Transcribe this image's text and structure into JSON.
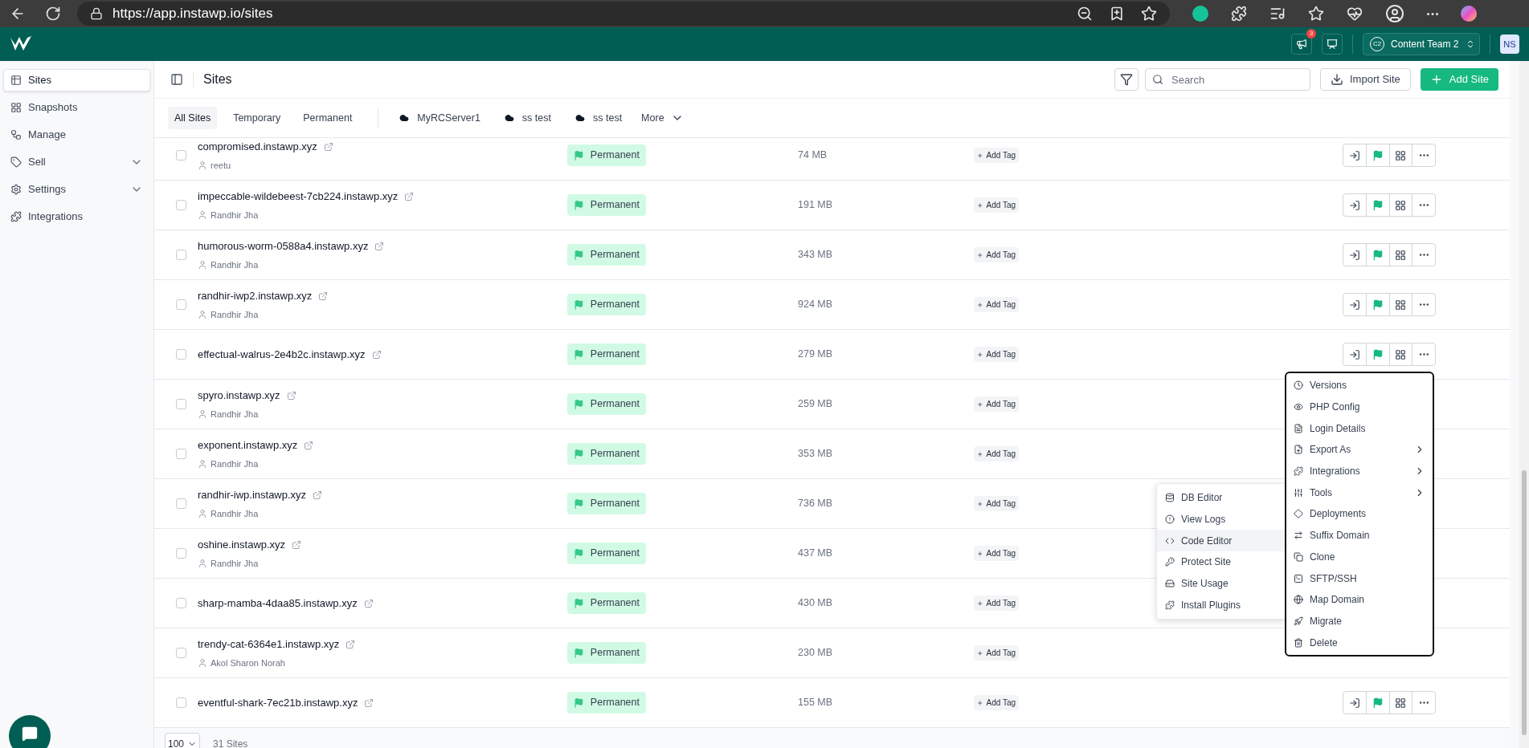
{
  "browser": {
    "url": "https://app.instawp.io/sites"
  },
  "header": {
    "notification_count": "3",
    "team": {
      "initials": "C2",
      "name": "Content Team 2"
    },
    "avatar": "NS"
  },
  "sidebar": {
    "items": [
      {
        "label": "Sites",
        "selected": true,
        "expandable": false
      },
      {
        "label": "Snapshots",
        "selected": false,
        "expandable": false
      },
      {
        "label": "Manage",
        "selected": false,
        "expandable": false
      },
      {
        "label": "Sell",
        "selected": false,
        "expandable": true
      },
      {
        "label": "Settings",
        "selected": false,
        "expandable": true
      },
      {
        "label": "Integrations",
        "selected": false,
        "expandable": false
      }
    ]
  },
  "page": {
    "title": "Sites",
    "search_placeholder": "Search",
    "import_button": "Import Site",
    "add_button": "Add Site"
  },
  "tabs": [
    {
      "label": "All Sites",
      "selected": true,
      "kind": "filter"
    },
    {
      "label": "Temporary",
      "selected": false,
      "kind": "filter"
    },
    {
      "label": "Permanent",
      "selected": false,
      "kind": "filter"
    },
    {
      "label": "MyRCServer1",
      "selected": false,
      "kind": "server"
    },
    {
      "label": "ss test",
      "selected": false,
      "kind": "server"
    },
    {
      "label": "ss test",
      "selected": false,
      "kind": "server"
    }
  ],
  "more_tab": "More",
  "rows": [
    {
      "name": "compromised.instawp.xyz",
      "user": "reetu",
      "status": "Permanent",
      "size": "74 MB",
      "tag_button": "Add Tag",
      "checked": false,
      "actions_shown": true
    },
    {
      "name": "impeccable-wildebeest-7cb224.instawp.xyz",
      "user": "Randhir Jha",
      "status": "Permanent",
      "size": "191 MB",
      "tag_button": "Add Tag",
      "checked": false,
      "actions_shown": true
    },
    {
      "name": "humorous-worm-0588a4.instawp.xyz",
      "user": "Randhir Jha",
      "status": "Permanent",
      "size": "343 MB",
      "tag_button": "Add Tag",
      "checked": false,
      "actions_shown": true
    },
    {
      "name": "randhir-iwp2.instawp.xyz",
      "user": "Randhir Jha",
      "status": "Permanent",
      "size": "924 MB",
      "tag_button": "Add Tag",
      "checked": false,
      "actions_shown": true
    },
    {
      "name": "effectual-walrus-2e4b2c.instawp.xyz",
      "status": "Permanent",
      "size": "279 MB",
      "tag_button": "Add Tag",
      "checked": false,
      "actions_shown": true
    },
    {
      "name": "spyro.instawp.xyz",
      "user": "Randhir Jha",
      "status": "Permanent",
      "size": "259 MB",
      "tag_button": "Add Tag",
      "checked": false,
      "actions_shown": false
    },
    {
      "name": "exponent.instawp.xyz",
      "user": "Randhir Jha",
      "status": "Permanent",
      "size": "353 MB",
      "tag_button": "Add Tag",
      "checked": false,
      "actions_shown": false
    },
    {
      "name": "randhir-iwp.instawp.xyz",
      "user": "Randhir Jha",
      "status": "Permanent",
      "size": "736 MB",
      "tag_button": "Add Tag",
      "checked": false,
      "actions_shown": false
    },
    {
      "name": "oshine.instawp.xyz",
      "user": "Randhir Jha",
      "status": "Permanent",
      "size": "437 MB",
      "tag_button": "Add Tag",
      "checked": false,
      "actions_shown": false
    },
    {
      "name": "sharp-mamba-4daa85.instawp.xyz",
      "status": "Permanent",
      "size": "430 MB",
      "tag_button": "Add Tag",
      "checked": false,
      "actions_shown": false
    },
    {
      "name": "trendy-cat-6364e1.instawp.xyz",
      "user": "Akol Sharon Norah",
      "status": "Permanent",
      "size": "230 MB",
      "tag_button": "Add Tag",
      "checked": false,
      "actions_shown": false
    },
    {
      "name": "eventful-shark-7ec21b.instawp.xyz",
      "status": "Permanent",
      "size": "155 MB",
      "tag_button": "Add Tag",
      "checked": false,
      "actions_shown": true
    }
  ],
  "footer": {
    "page_size": "100",
    "count": "31 Sites"
  },
  "context_menu": {
    "items": [
      {
        "label": "Versions",
        "submenu": false
      },
      {
        "label": "PHP Config",
        "submenu": false
      },
      {
        "label": "Login Details",
        "submenu": false
      },
      {
        "label": "Export As",
        "submenu": true
      },
      {
        "label": "Integrations",
        "submenu": true
      },
      {
        "label": "Tools",
        "submenu": true
      },
      {
        "label": "Deployments",
        "submenu": false
      },
      {
        "label": "Suffix Domain",
        "submenu": false
      },
      {
        "label": "Clone",
        "submenu": false
      },
      {
        "label": "SFTP/SSH",
        "submenu": false
      },
      {
        "label": "Map Domain",
        "submenu": false
      },
      {
        "label": "Migrate",
        "submenu": false
      },
      {
        "label": "Delete",
        "submenu": false
      }
    ]
  },
  "tools_submenu": {
    "items": [
      {
        "label": "DB Editor",
        "selected": false
      },
      {
        "label": "View Logs",
        "selected": false
      },
      {
        "label": "Code Editor",
        "selected": true
      },
      {
        "label": "Protect Site",
        "selected": false
      },
      {
        "label": "Site Usage",
        "selected": false
      },
      {
        "label": "Install Plugins",
        "selected": false
      }
    ]
  }
}
